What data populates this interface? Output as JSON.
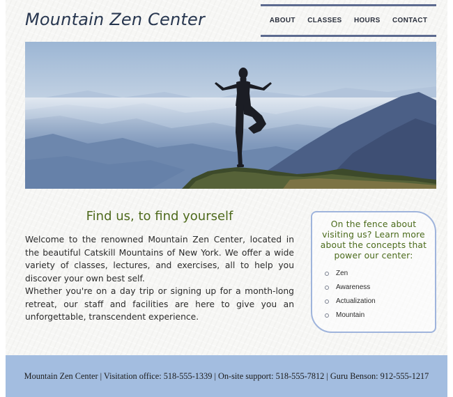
{
  "header": {
    "site_title": "Mountain Zen Center"
  },
  "nav": {
    "items": [
      {
        "label": "ABOUT"
      },
      {
        "label": "CLASSES"
      },
      {
        "label": "HOURS"
      },
      {
        "label": "CONTACT"
      }
    ]
  },
  "main": {
    "heading": "Find us, to find yourself",
    "paragraphs": [
      "Welcome to the renowned Mountain Zen Center, located in the beautiful Catskill Mountains of New York. We offer a wide variety of classes, lectures, and exercises, all to help you discover your own best self.",
      "Whether you're on a day trip or signing up for a month-long retreat, our staff and facilities are here to give you an unforgettable, transcendent experience."
    ]
  },
  "aside": {
    "heading": "On the fence about visiting us? Learn more about the concepts that power our center:",
    "items": [
      "Zen",
      "Awareness",
      "Actualization",
      "Mountain"
    ]
  },
  "footer": {
    "text": "Mountain Zen Center | Visitation office: 518-555-1339 | On-site support: 518-555-7812 | Guru Benson: 912-555-1217"
  },
  "colors": {
    "title": "#27364f",
    "nav_border": "#5c6a8f",
    "heading_green": "#4e6a1c",
    "aside_border": "#9fb4dc",
    "footer_bg": "#a3bde0"
  }
}
